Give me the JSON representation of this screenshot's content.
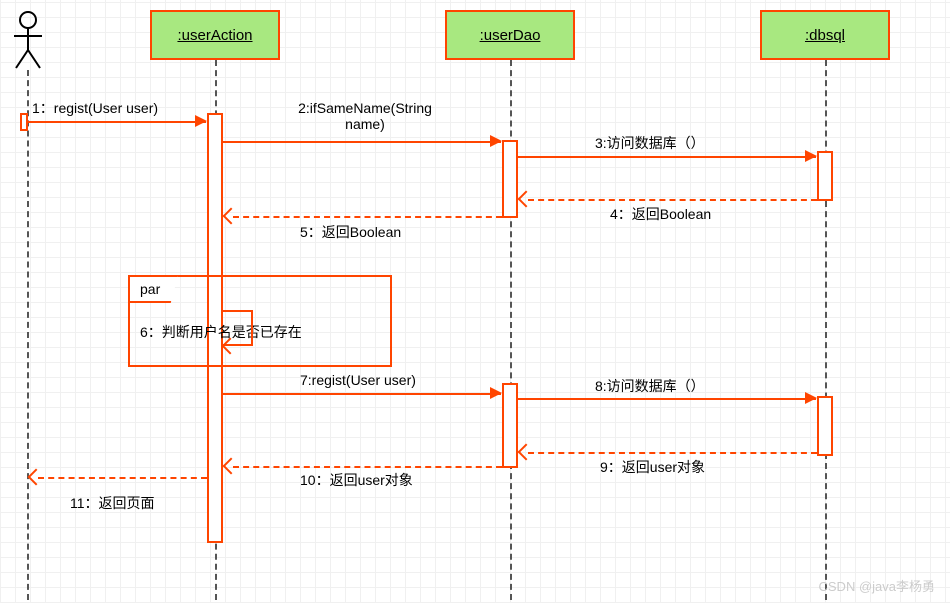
{
  "diagram_type": "UML Sequence Diagram",
  "actor": {
    "label": ""
  },
  "participants": {
    "userAction": ":userAction",
    "userDao": ":userDao",
    "dbsql": ":dbsql"
  },
  "messages": {
    "m1": "1：regist(User user)",
    "m2_line1": "2:ifSameName(String",
    "m2_line2": "name)",
    "m3": "3:访问数据库（）",
    "m4": "4：返回Boolean",
    "m5": "5：返回Boolean",
    "m6": "6：判断用户名是否已存在",
    "m7": "7:regist(User user)",
    "m8": "8:访问数据库（）",
    "m9": "9：返回user对象",
    "m10": "10：返回user对象",
    "m11": "11：返回页面"
  },
  "fragment": {
    "type": "par"
  },
  "watermark": "CSDN @java李杨勇"
}
